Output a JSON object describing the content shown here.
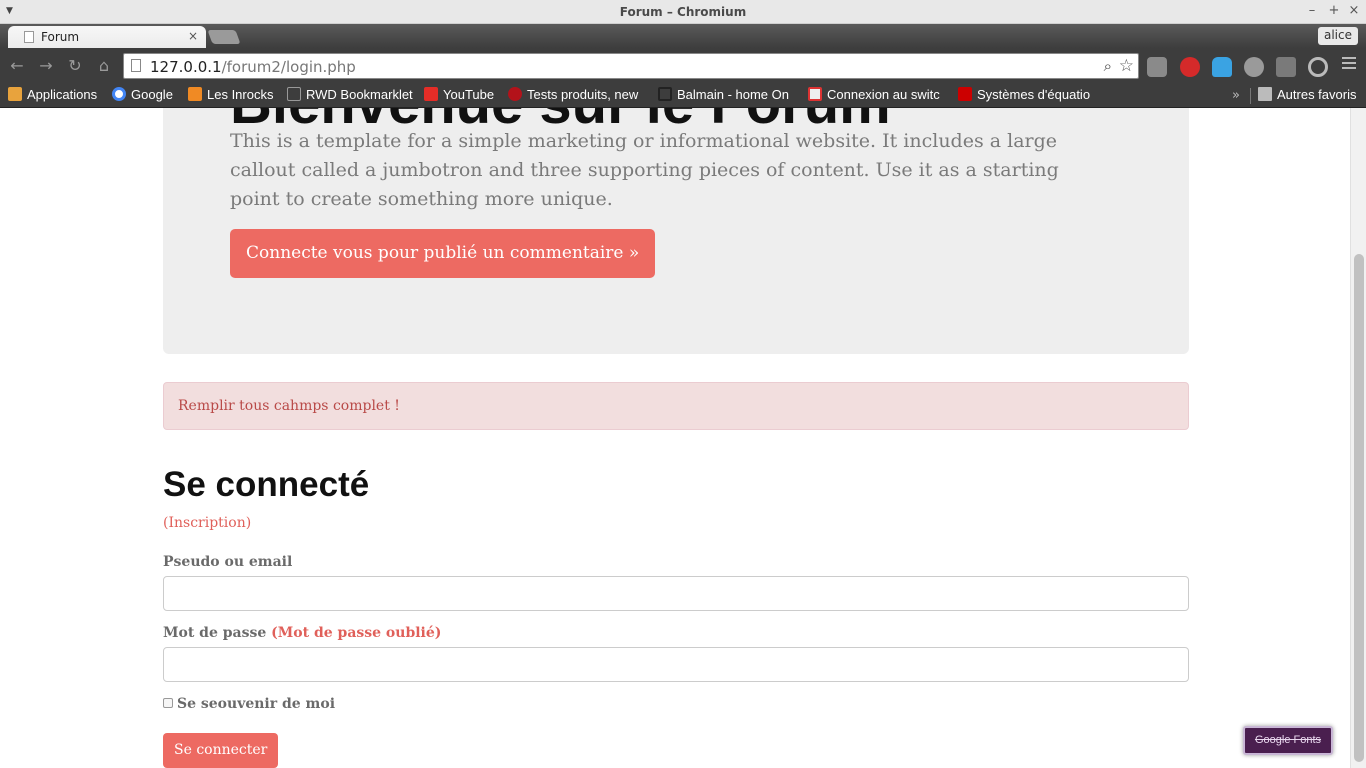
{
  "window": {
    "title": "Forum – Chromium",
    "minimize": "–",
    "maximize": "+",
    "close": "×"
  },
  "tabs": [
    {
      "label": "Forum",
      "close": "×"
    }
  ],
  "profile": {
    "name": "alice"
  },
  "omnibox": {
    "host": "127.0.0.1",
    "path": "/forum2/login.php"
  },
  "bookmarks": {
    "items": [
      {
        "label": "Applications",
        "icon": "apps-grid-icon",
        "color": "#e8a33d"
      },
      {
        "label": "Google",
        "icon": "google-icon",
        "color": "#4285f4"
      },
      {
        "label": "Les Inrocks",
        "icon": "inrocks-icon",
        "color": "#f08a24"
      },
      {
        "label": "RWD Bookmarklet",
        "icon": "page-icon",
        "color": "#888888"
      },
      {
        "label": "YouTube",
        "icon": "youtube-icon",
        "color": "#e52d27"
      },
      {
        "label": "Tests produits, new",
        "icon": "clubic-icon",
        "color": "#b3121a"
      },
      {
        "label": "Balmain - home On",
        "icon": "balmain-icon",
        "color": "#222222"
      },
      {
        "label": "Connexion au switc",
        "icon": "switch-icon",
        "color": "#d33"
      },
      {
        "label": "Systèmes d'équatio",
        "icon": "free-icon",
        "color": "#cc0000"
      }
    ],
    "more": "»",
    "other": "Autres favoris"
  },
  "page": {
    "jumbotron": {
      "heading": "Bienvenue sur le Forum",
      "text": "This is a template for a simple marketing or informational website. It includes a large callout called a jumbotron and three supporting pieces of content. Use it as a starting point to create something more unique.",
      "button": "Connecte vous pour publié un commentaire »"
    },
    "alert": "Remplir tous cahmps complet !",
    "form": {
      "title": "Se connecté",
      "register_link": "(Inscription)",
      "login_label": "Pseudo ou email",
      "login_value": "",
      "password_label": "Mot de passe",
      "forgot_link": "(Mot de passe oublié)",
      "password_value": "",
      "remember_label": "Se seouvenir de moi",
      "submit": "Se connecter"
    }
  },
  "widgets": {
    "google_fonts": "Google Fonts"
  },
  "colors": {
    "accent": "#ed6a62",
    "alert_bg": "#f2dede",
    "alert_text": "#b94a48",
    "jumbotron_bg": "#eeeeee",
    "chrome_dark": "#3d3d3d"
  }
}
